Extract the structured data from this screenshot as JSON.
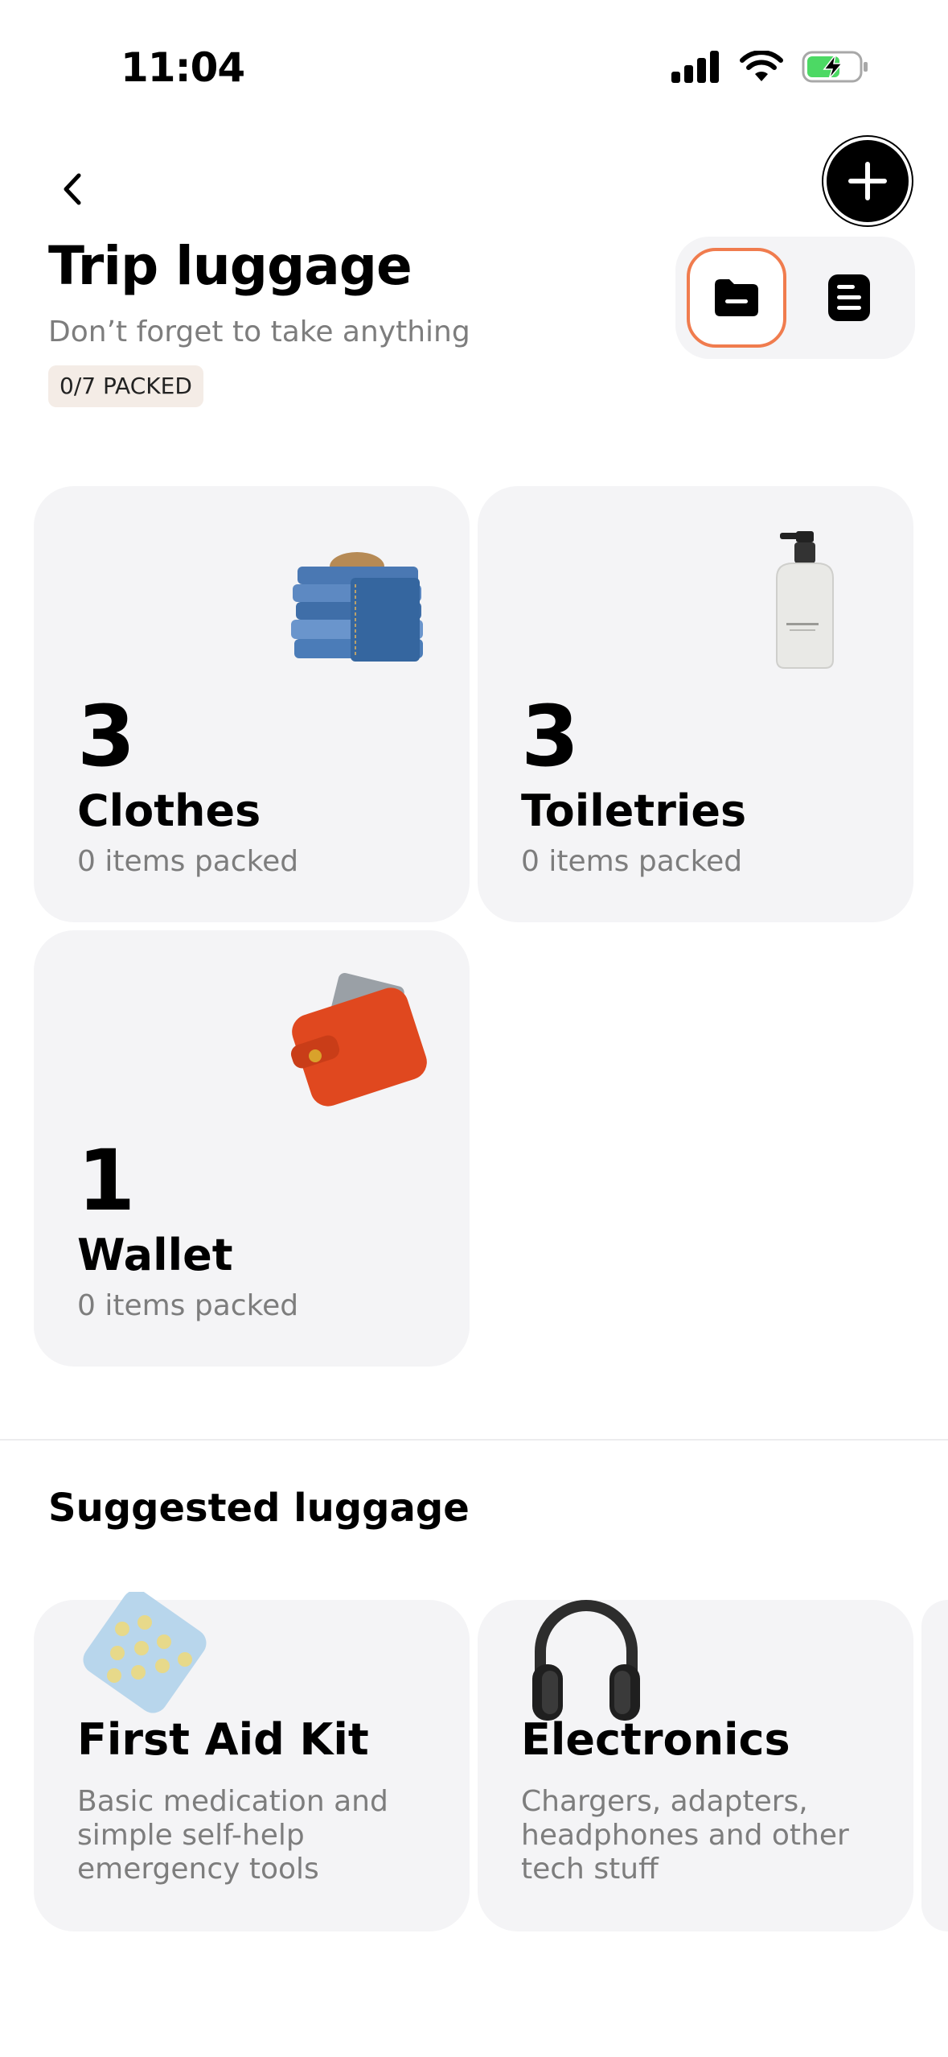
{
  "status_bar": {
    "time": "11:04"
  },
  "header": {
    "title": "Trip luggage",
    "subtitle": "Don’t forget to take anything",
    "packed_badge": "0/7 PACKED"
  },
  "categories": [
    {
      "count": "3",
      "name": "Clothes",
      "meta": "0 items packed",
      "icon": "jeans-image"
    },
    {
      "count": "3",
      "name": "Toiletries",
      "meta": "0 items packed",
      "icon": "bottle-image"
    },
    {
      "count": "1",
      "name": "Wallet",
      "meta": "0 items packed",
      "icon": "wallet-image"
    }
  ],
  "suggested": {
    "title": "Suggested luggage",
    "items": [
      {
        "name": "First Aid Kit",
        "desc": "Basic medication and simple self-help emergency tools",
        "icon": "pills-image"
      },
      {
        "name": "Electronics",
        "desc": "Chargers, adapters, headphones and other tech stuff",
        "icon": "headphones-image"
      }
    ]
  },
  "colors": {
    "accent": "#f07c4e",
    "card_bg": "#f4f4f6",
    "muted_text": "#7d7d7d",
    "badge_bg": "#f4ece6"
  }
}
